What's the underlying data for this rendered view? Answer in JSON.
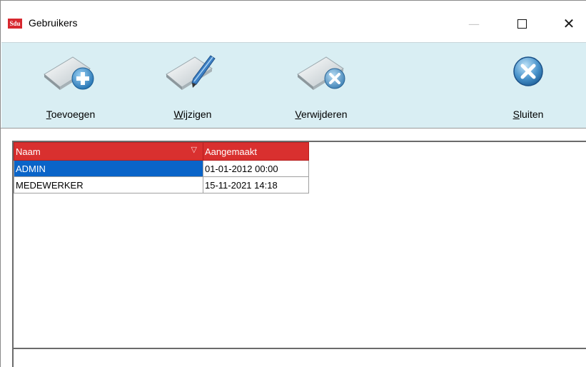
{
  "window": {
    "logo_text": "Sdu",
    "title": "Gebruikers",
    "minimize_glyph": "—",
    "close_glyph": "✕"
  },
  "toolbar": {
    "add": {
      "mnemonic": "T",
      "rest": "oevoegen",
      "icon": "add-document-icon"
    },
    "edit": {
      "mnemonic": "W",
      "rest": "ijzigen",
      "icon": "edit-document-icon"
    },
    "delete": {
      "mnemonic": "V",
      "rest": "erwijderen",
      "icon": "delete-document-icon"
    },
    "close": {
      "mnemonic": "S",
      "rest": "luiten",
      "icon": "close-circle-icon"
    }
  },
  "grid": {
    "columns": [
      {
        "label": "Naam",
        "sorted": true
      },
      {
        "label": "Aangemaakt"
      }
    ],
    "sort_glyph": "▽",
    "rows": [
      {
        "naam": "ADMIN",
        "aangemaakt": "01-01-2012 00:00",
        "selected": true
      },
      {
        "naam": "MEDEWERKER",
        "aangemaakt": "15-11-2021 14:18",
        "selected": false
      }
    ]
  },
  "colors": {
    "header_red": "#d9302f",
    "toolbar_bg": "#d9eef3",
    "selection_blue": "#0a64c8"
  }
}
